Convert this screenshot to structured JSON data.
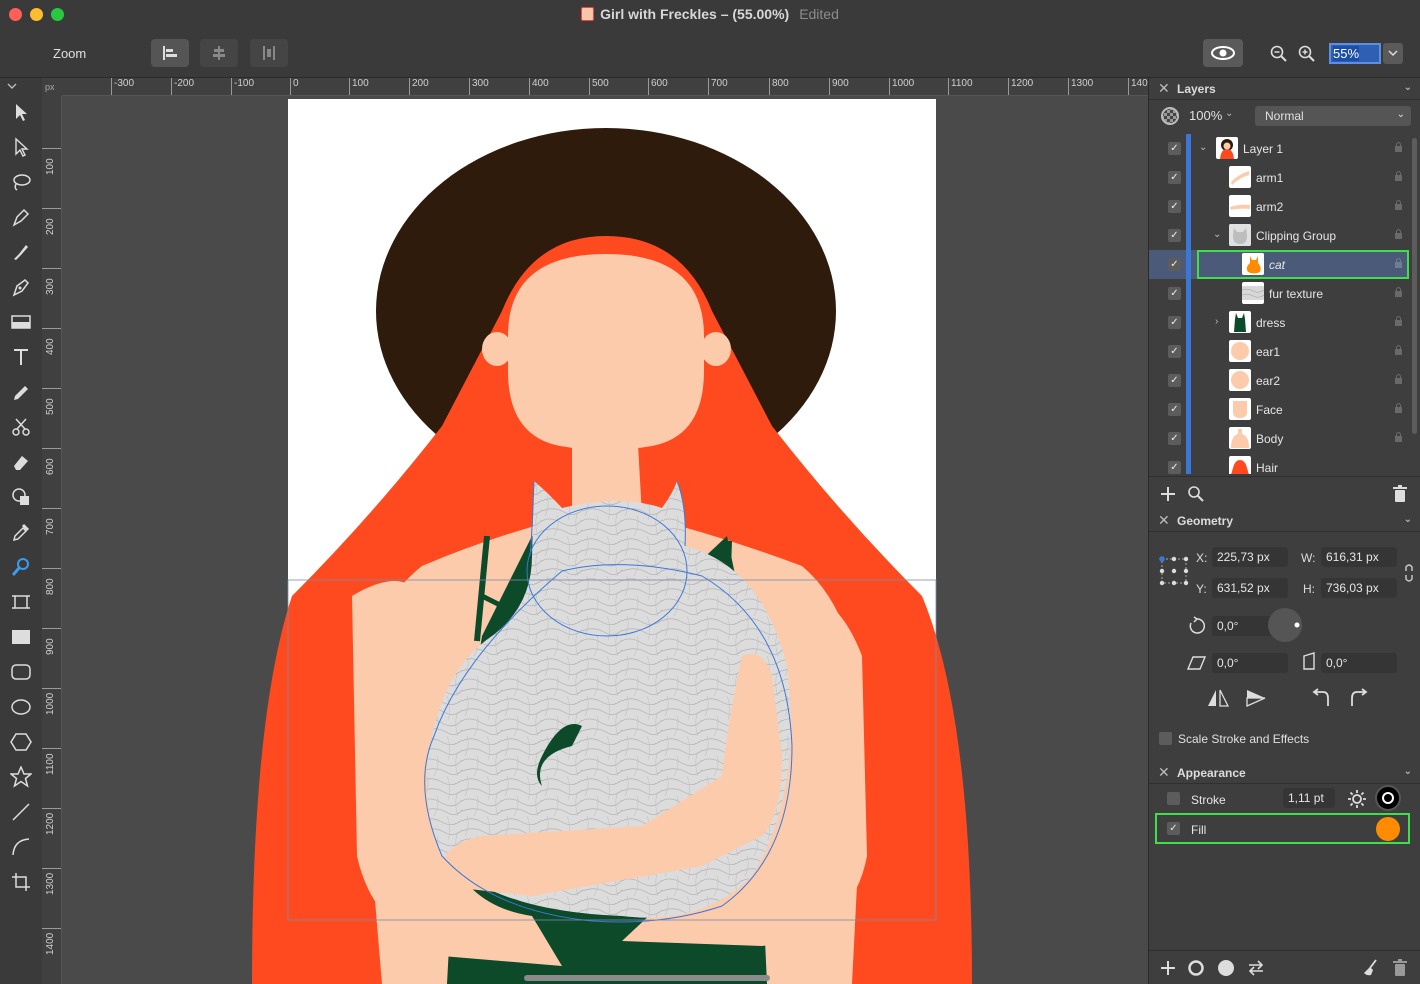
{
  "window": {
    "title": "Girl with Freckles – (55.00%)",
    "status": "Edited"
  },
  "toolbar": {
    "tool_name": "Zoom",
    "zoom_value": "55%"
  },
  "rulers": {
    "unit": "px",
    "top_ticks": [
      "-300",
      "-200",
      "-100",
      "0",
      "100",
      "200",
      "300",
      "400",
      "500",
      "600",
      "700",
      "800",
      "900",
      "1000",
      "1100",
      "1200",
      "1300",
      "140"
    ],
    "left_ticks": [
      "100",
      "200",
      "300",
      "400",
      "500",
      "600",
      "700",
      "800",
      "900",
      "1000",
      "1100",
      "1200",
      "1300",
      "1400"
    ]
  },
  "layers": {
    "title": "Layers",
    "opacity": "100%",
    "blend_mode": "Normal",
    "items": [
      {
        "name": "Layer 1",
        "expanded": true
      },
      {
        "name": "arm1"
      },
      {
        "name": "arm2"
      },
      {
        "name": "Clipping Group",
        "expanded": true
      },
      {
        "name": "cat",
        "selected": true
      },
      {
        "name": "fur texture"
      },
      {
        "name": "dress",
        "collapsed": true
      },
      {
        "name": "ear1"
      },
      {
        "name": "ear2"
      },
      {
        "name": "Face"
      },
      {
        "name": "Body"
      },
      {
        "name": "Hair"
      }
    ]
  },
  "geometry": {
    "title": "Geometry",
    "x_label": "X:",
    "x": "225,73 px",
    "y_label": "Y:",
    "y": "631,52 px",
    "w_label": "W:",
    "w": "616,31 px",
    "h_label": "H:",
    "h": "736,03 px",
    "rotation": "0,0°",
    "shear": "0,0°",
    "skew": "0,0°",
    "scale_stroke": "Scale Stroke and Effects"
  },
  "appearance": {
    "title": "Appearance",
    "stroke_label": "Stroke",
    "stroke_width": "1,11 pt",
    "fill_label": "Fill",
    "fill_color": "#ff8c00",
    "stroke_color": "#000000"
  },
  "colors": {
    "hair": "#ff4a1f",
    "hat": "#2e1b0c",
    "skin": "#fccbac",
    "dress": "#0c4a2a",
    "accent": "#3a78d8",
    "highlight": "#3ee04a"
  }
}
